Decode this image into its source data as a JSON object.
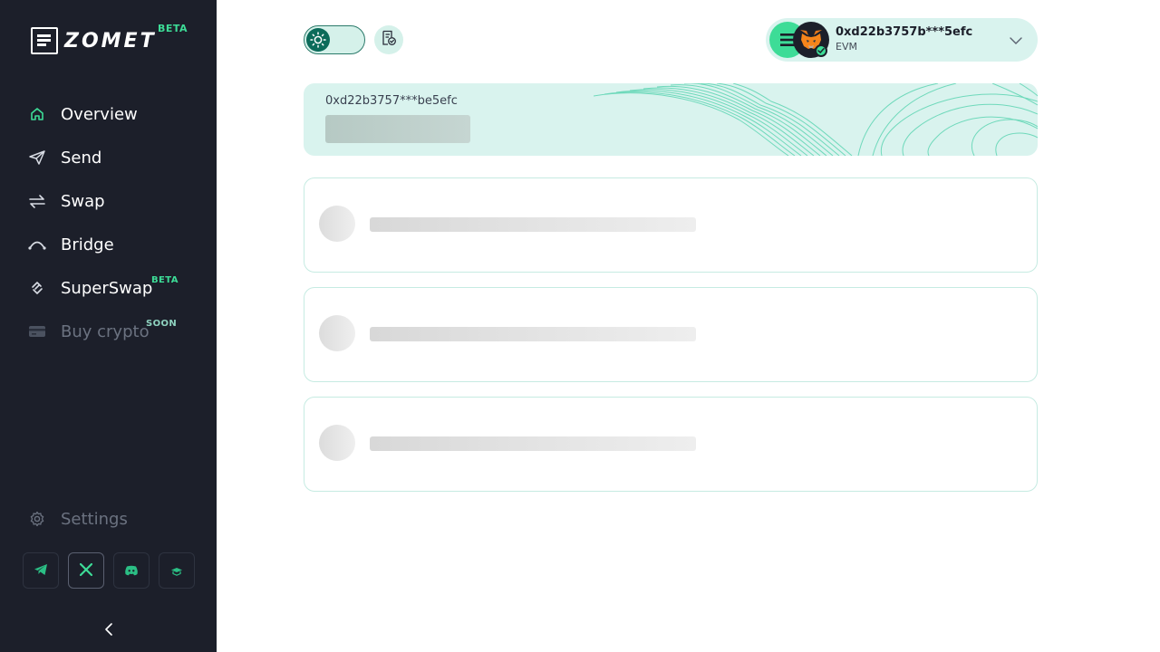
{
  "app": {
    "brand": "ZOMET",
    "brand_badge": "BETA"
  },
  "sidebar": {
    "items": [
      {
        "label": "Overview",
        "icon": "home-icon",
        "active": true
      },
      {
        "label": "Send",
        "icon": "send-icon"
      },
      {
        "label": "Swap",
        "icon": "swap-icon"
      },
      {
        "label": "Bridge",
        "icon": "bridge-icon"
      },
      {
        "label": "SuperSwap",
        "icon": "superswap-icon",
        "badge": "BETA"
      },
      {
        "label": "Buy crypto",
        "icon": "card-icon",
        "badge": "SOON",
        "disabled": true
      }
    ],
    "settings_label": "Settings",
    "socials": [
      "telegram-icon",
      "x-icon",
      "discord-icon",
      "docs-icon"
    ]
  },
  "header": {
    "theme": "light",
    "wallet": {
      "address": "0xd22b3757b***5efc",
      "network": "EVM"
    }
  },
  "balance": {
    "address": "0xd22b3757***be5efc"
  },
  "colors": {
    "accent": "#3ddc97",
    "sidebar_bg": "#1c1f2a",
    "card_bg": "#d9f3ee"
  }
}
